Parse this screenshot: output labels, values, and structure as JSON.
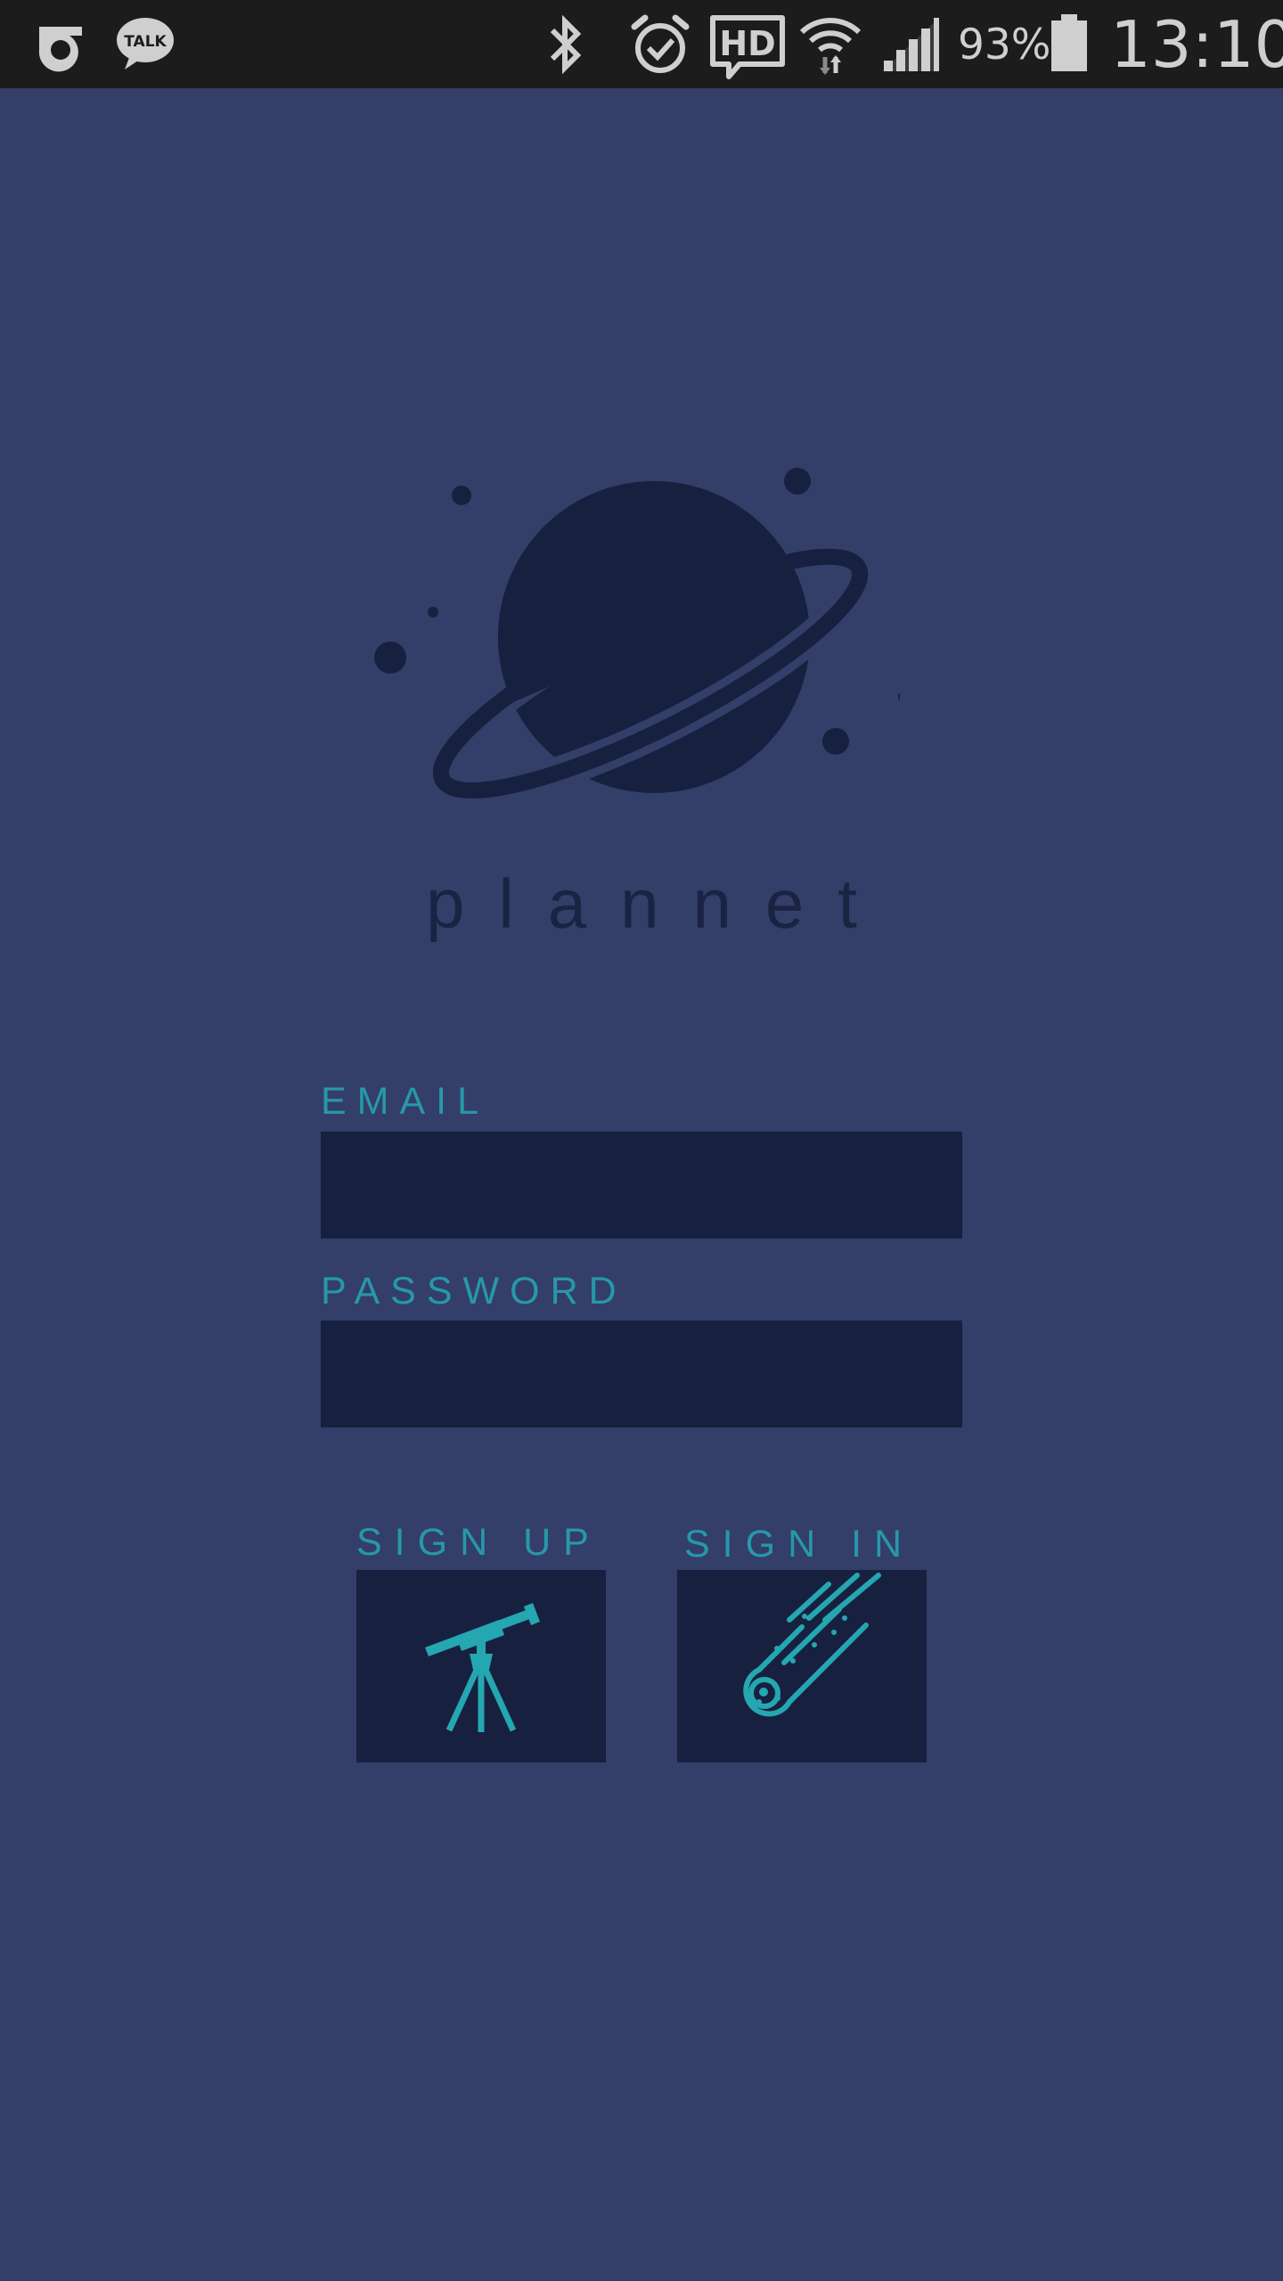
{
  "status_bar": {
    "battery_percent": "93%",
    "time": "13:10",
    "icons": [
      "olleh-icon",
      "kakaotalk-icon",
      "bluetooth-icon",
      "alarm-icon",
      "hd-voice-icon",
      "wifi-icon",
      "signal-icon",
      "battery-icon"
    ],
    "talk_icon_text": "TALK",
    "hd_icon_text": "HD"
  },
  "brand": {
    "name": "plannet",
    "logo_icon": "planet-icon"
  },
  "form": {
    "email_label": "EMAIL",
    "email_value": "",
    "password_label": "PASSWORD",
    "password_value": ""
  },
  "actions": {
    "signup_label": "SIGN UP",
    "signup_icon": "telescope-icon",
    "signin_label": "SIGN IN",
    "signin_icon": "comet-icon"
  },
  "colors": {
    "background": "#333e69",
    "status_bar": "#1c1c1c",
    "dark_navy": "#182040",
    "accent_teal": "#2798a8"
  }
}
